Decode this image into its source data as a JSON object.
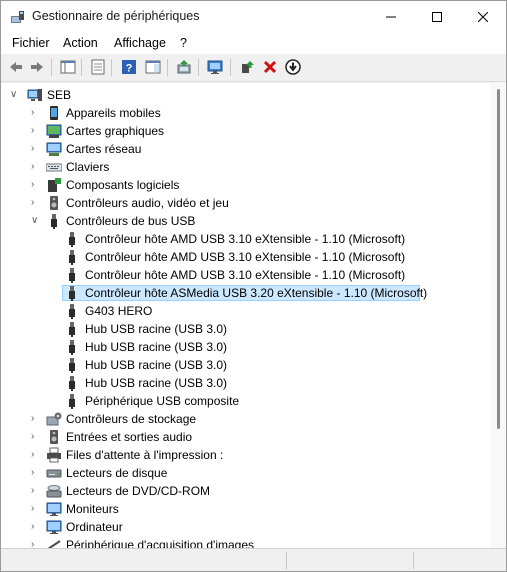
{
  "window": {
    "title": "Gestionnaire de périphériques"
  },
  "menu": [
    "Fichier",
    "Action",
    "Affichage",
    "?"
  ],
  "tree": {
    "root": "SEB",
    "categories": [
      "Appareils mobiles",
      "Cartes graphiques",
      "Cartes réseau",
      "Claviers",
      "Composants logiciels",
      "Contrôleurs audio, vidéo et jeu",
      "Contrôleurs de bus USB"
    ],
    "usb_children": [
      "Contrôleur hôte AMD USB 3.10 eXtensible - 1.10 (Microsoft)",
      "Contrôleur hôte AMD USB 3.10 eXtensible - 1.10 (Microsoft)",
      "Contrôleur hôte AMD USB 3.10 eXtensible - 1.10 (Microsoft)",
      "Contrôleur hôte ASMedia USB 3.20 eXtensible - 1.10 (Microsoft)",
      "G403 HERO",
      "Hub USB racine (USB 3.0)",
      "Hub USB racine (USB 3.0)",
      "Hub USB racine (USB 3.0)",
      "Hub USB racine (USB 3.0)",
      "Périphérique USB composite"
    ],
    "categories_after": [
      "Contrôleurs de stockage",
      "Entrées et sorties audio",
      "Files d'attente à l'impression :",
      "Lecteurs de disque",
      "Lecteurs de DVD/CD-ROM",
      "Moniteurs",
      "Ordinateur",
      "Périphérique d'acquisition d'images"
    ]
  },
  "colors": {
    "selection_bg": "#cce8ff",
    "selection_border": "#99d1ff",
    "remove_red": "#d01010"
  }
}
